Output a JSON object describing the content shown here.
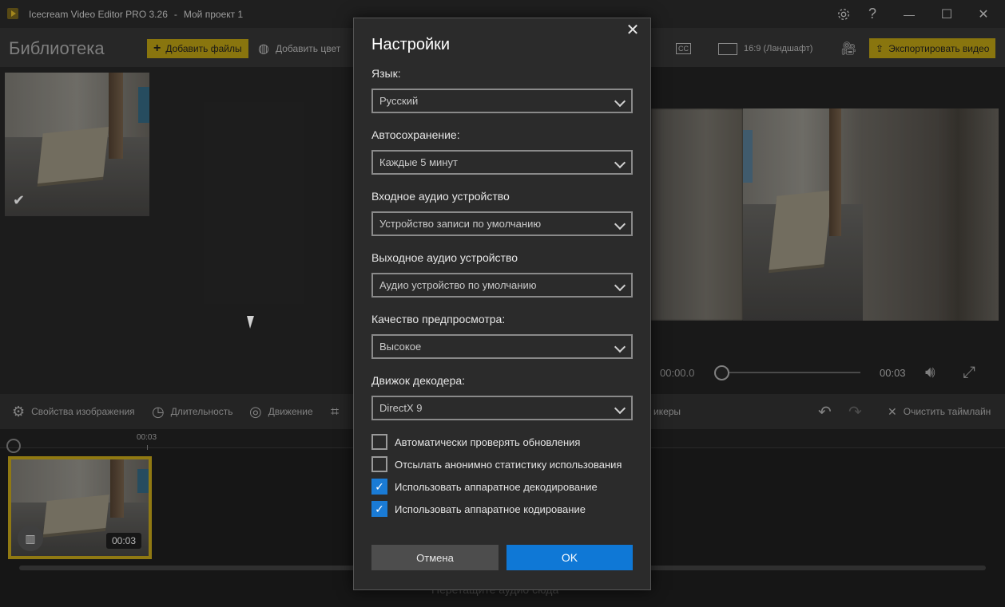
{
  "titlebar": {
    "app_name": "Icecream Video Editor PRO 3.26",
    "separator": "-",
    "project": "Мой проект 1",
    "settings_icon": "gear-icon",
    "help_label": "?",
    "minimize_label": "—",
    "maximize_label": "☐",
    "close_label": "✕"
  },
  "library": {
    "title": "Библиотека",
    "add_files": "Добавить файлы",
    "add_color": "Добавить цвет",
    "aspect": "16:9 (Ландшафт)",
    "export": "Экспортировать видео",
    "thumb_check": "✔"
  },
  "player": {
    "current_time": "00:00.0",
    "total_time": "00:03",
    "progress": 0
  },
  "toolbar": {
    "image_props": "Свойства изображения",
    "duration": "Длительность",
    "motion": "Движение",
    "stickers_partial": "икеры",
    "clear_timeline": "Очистить таймлайн"
  },
  "timeline": {
    "ruler_mark": "00:03",
    "clip_duration": "00:03",
    "drag_audio_hint": "Перетащите аудио сюда"
  },
  "dialog": {
    "title": "Настройки",
    "close_label": "✕",
    "language": {
      "label": "Язык:",
      "value": "Русский"
    },
    "autosave": {
      "label": "Автосохранение:",
      "value": "Каждые 5 минут"
    },
    "audio_in": {
      "label": "Входное аудио устройство",
      "value": "Устройство записи по умолчанию"
    },
    "audio_out": {
      "label": "Выходное аудио устройство",
      "value": "Аудио устройство по умолчанию"
    },
    "preview_quality": {
      "label": "Качество предпросмотра:",
      "value": "Высокое"
    },
    "decoder": {
      "label": "Движок декодера:",
      "value": "DirectX 9"
    },
    "checkboxes": [
      {
        "label": "Автоматически проверять обновления",
        "checked": false
      },
      {
        "label": "Отсылать анонимно статистику использования",
        "checked": false
      },
      {
        "label": "Использовать аппаратное декодирование",
        "checked": true
      },
      {
        "label": "Использовать аппаратное кодирование",
        "checked": true
      }
    ],
    "cancel": "Отмена",
    "ok": "OK"
  },
  "colors": {
    "accent": "#a88f12",
    "ok_blue": "#0f78d6",
    "checkbox_blue": "#1a7bd5"
  }
}
